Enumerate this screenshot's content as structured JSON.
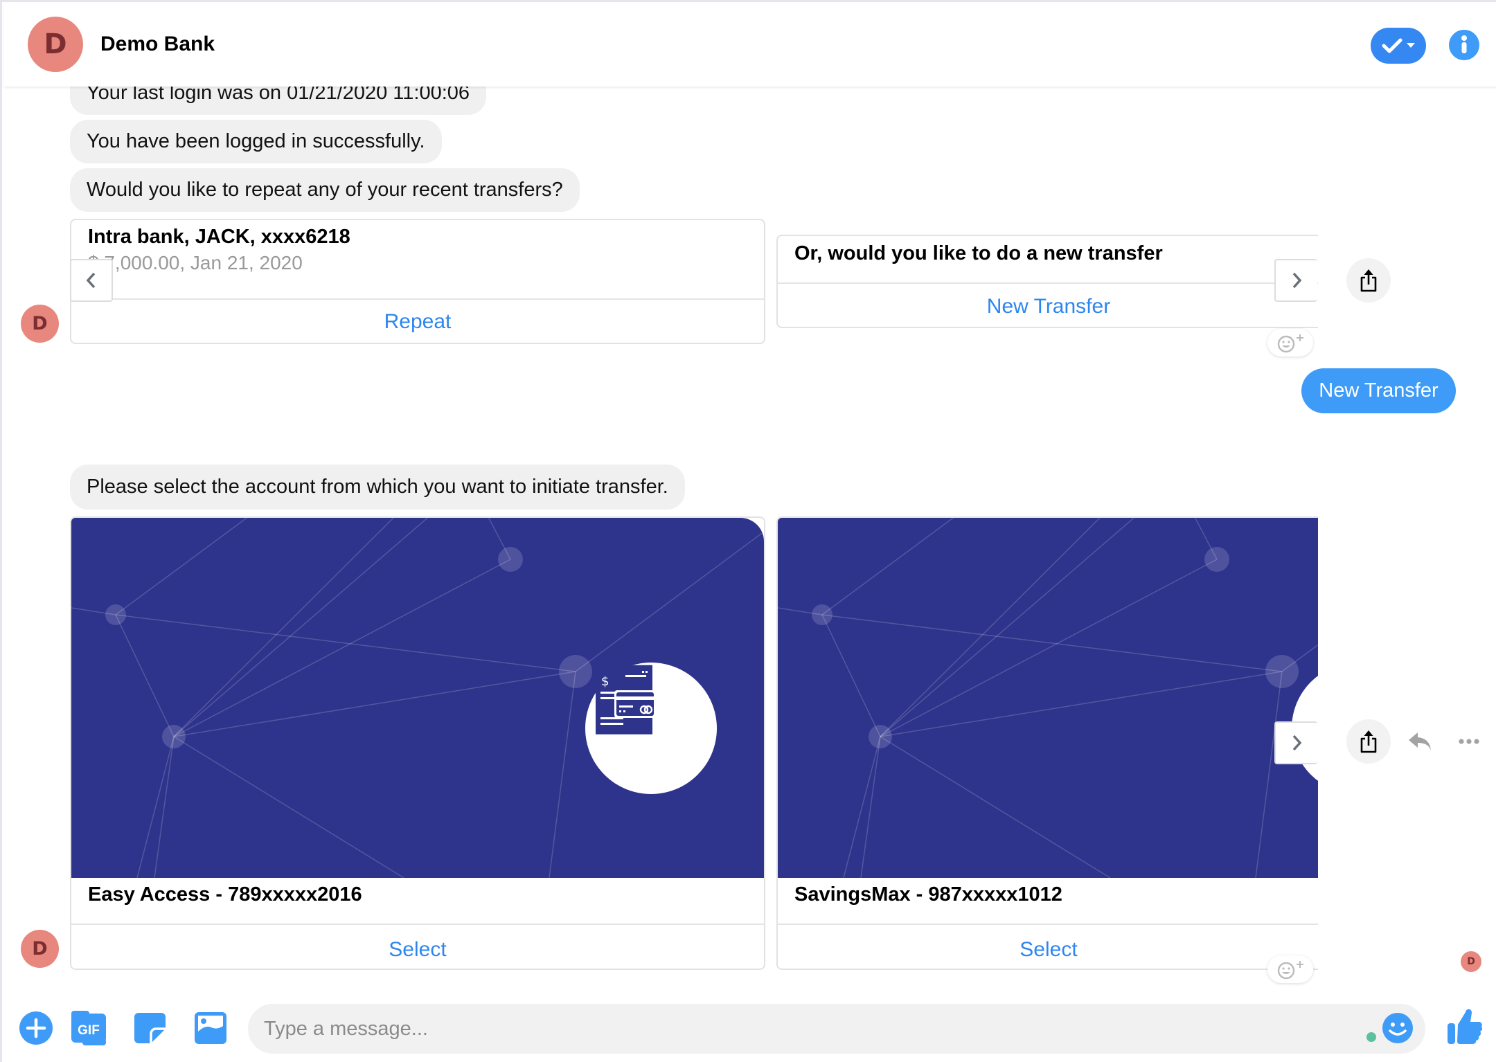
{
  "header": {
    "avatar_letter": "D",
    "title": "Demo Bank",
    "check_icon": "check-dropdown-icon",
    "info_icon": "info-icon"
  },
  "colors": {
    "accent": "#3e9bf7",
    "link": "#2d86f0",
    "avatar_bg": "#e8877e",
    "avatar_text": "#7a2e31",
    "hero_bg": "#2e338c",
    "bubble_bg": "#f0f0f0"
  },
  "messages": [
    {
      "text": "Your last login was on 01/21/2020 11:00:06"
    },
    {
      "text": "You have been logged in successfully."
    },
    {
      "text": "Would you like to repeat any of your recent transfers?"
    }
  ],
  "recent_transfers": {
    "cards": [
      {
        "title": "Intra bank, JACK, xxxx6218",
        "subtitle": "$ 7,000.00, Jan 21, 2020",
        "action": "Repeat"
      },
      {
        "title": "Or, would you like to do a new transfer",
        "action": "New Transfer"
      }
    ]
  },
  "user_reply": "New Transfer",
  "account_prompt": "Please select the account from which you want to initiate transfer.",
  "accounts": {
    "cards": [
      {
        "title": "Easy Access - 789xxxxx2016",
        "action": "Select",
        "image_icon": "bill-credit-card-icon"
      },
      {
        "title": "SavingsMax - 987xxxxx1012",
        "action": "Select",
        "image_icon": "bill-credit-card-icon"
      }
    ]
  },
  "bot_avatar_letter": "D",
  "read_receipt_letter": "D",
  "composer": {
    "placeholder": "Type a message...",
    "value": "",
    "gif_label": "GIF",
    "icons": [
      "plus-icon",
      "gif-icon",
      "sticker-icon",
      "image-icon",
      "emoji-icon",
      "thumbs-up-icon"
    ]
  }
}
